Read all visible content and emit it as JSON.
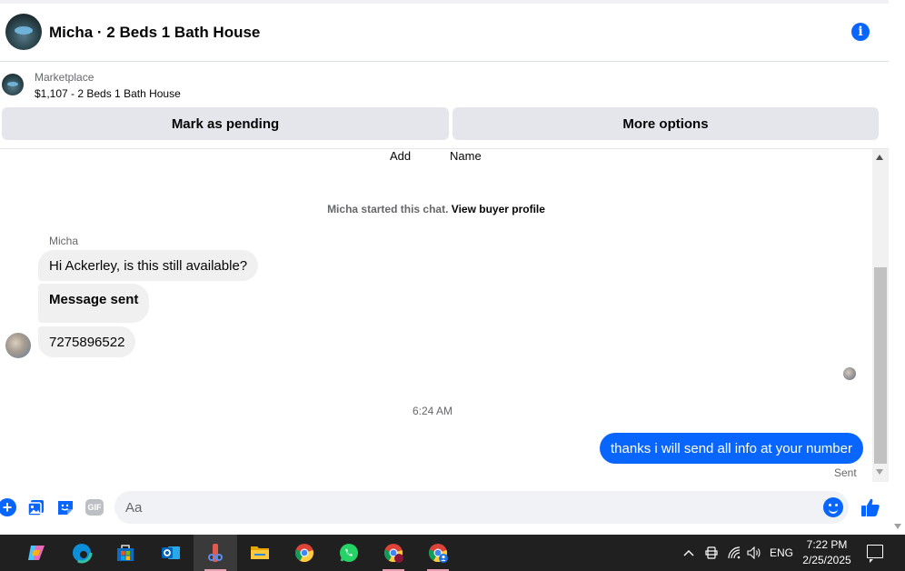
{
  "header": {
    "title": "Micha · 2 Beds 1 Bath House"
  },
  "listing": {
    "label": "Marketplace",
    "title": "$1,107 - 2 Beds 1 Bath House",
    "mark_pending_label": "Mark as pending",
    "more_options_label": "More options"
  },
  "chat": {
    "add_label": "Add",
    "name_label": "Name",
    "started_text": "Micha started this chat.",
    "buyer_profile_link": "View buyer profile",
    "sender_name": "Micha",
    "messages_in": [
      "Hi Ackerley, is this still available?",
      "Message sent",
      "7275896522"
    ],
    "timestamp": "6:24 AM",
    "message_out": "thanks i will send all info at your number",
    "sent_status": "Sent"
  },
  "composer": {
    "placeholder": "Aa",
    "gif_label": "GIF"
  },
  "taskbar": {
    "language": "ENG",
    "time": "7:22 PM",
    "date": "2/25/2025"
  },
  "colors": {
    "accent": "#0866ff",
    "bubble_in": "#f0f0f0",
    "taskbar": "#202020"
  }
}
